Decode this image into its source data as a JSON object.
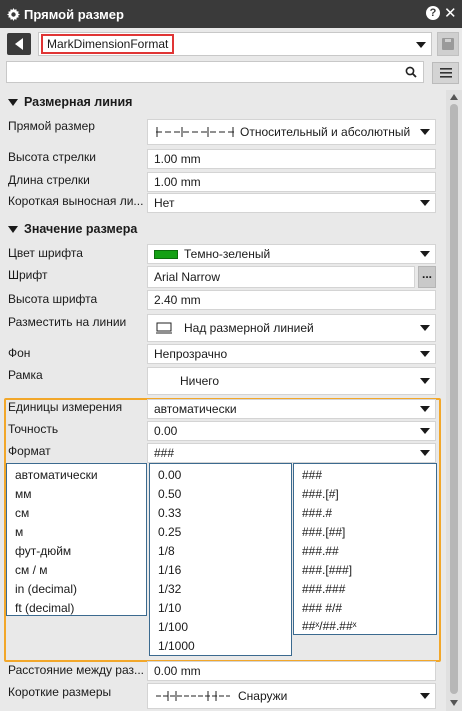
{
  "window": {
    "title": "Прямой размер"
  },
  "toolbar": {
    "style_value": "MarkDimensionFormat",
    "search_placeholder": ""
  },
  "sections": {
    "dim_line": "Размерная линия",
    "dim_value": "Значение размера"
  },
  "props": {
    "linear_dim": {
      "label": "Прямой размер",
      "value": "Относительный и абсолютный",
      "icon": "dimension-style-icon"
    },
    "arrow_height": {
      "label": "Высота стрелки",
      "value": "1.00 mm"
    },
    "arrow_length": {
      "label": "Длина стрелки",
      "value": "1.00 mm"
    },
    "short_ext": {
      "label": "Короткая выносная ли...",
      "value": "Нет"
    },
    "font_color": {
      "label": "Цвет шрифта",
      "value": "Темно-зеленый",
      "color": "#14a014"
    },
    "font": {
      "label": "Шрифт",
      "value": "Arial Narrow",
      "button": "..."
    },
    "font_height": {
      "label": "Высота шрифта",
      "value": "2.40 mm"
    },
    "place_on_line": {
      "label": "Разместить на линии",
      "value": "Над размерной линией"
    },
    "background": {
      "label": "Фон",
      "value": "Непрозрачно"
    },
    "frame": {
      "label": "Рамка",
      "value": "Ничего"
    },
    "units": {
      "label": "Единицы измерения",
      "value": "автоматически"
    },
    "precision": {
      "label": "Точность",
      "value": "0.00"
    },
    "format": {
      "label": "Формат",
      "value": "###"
    },
    "distance": {
      "label": "Расстояние между раз...",
      "value": "0.00 mm"
    },
    "short_dims": {
      "label": "Короткие размеры",
      "value": "Снаружи"
    }
  },
  "lists": {
    "units": [
      "автоматически",
      "мм",
      "см",
      "м",
      "фут-дюйм",
      "см / м",
      "in (decimal)",
      "ft (decimal)"
    ],
    "precision": [
      "0.00",
      "0.50",
      "0.33",
      "0.25",
      "1/8",
      "1/16",
      "1/32",
      "1/10",
      "1/100",
      "1/1000"
    ],
    "format": [
      "###",
      "###.[#]",
      "###.#",
      "###.[##]",
      "###.##",
      "###.[###]",
      "###.###",
      "### #/#",
      "##ˣ/##.##ˣ"
    ]
  },
  "colors": {
    "highlight": "#f2a72a",
    "style_outline": "#e03535",
    "list_border": "#3b6a8f"
  }
}
